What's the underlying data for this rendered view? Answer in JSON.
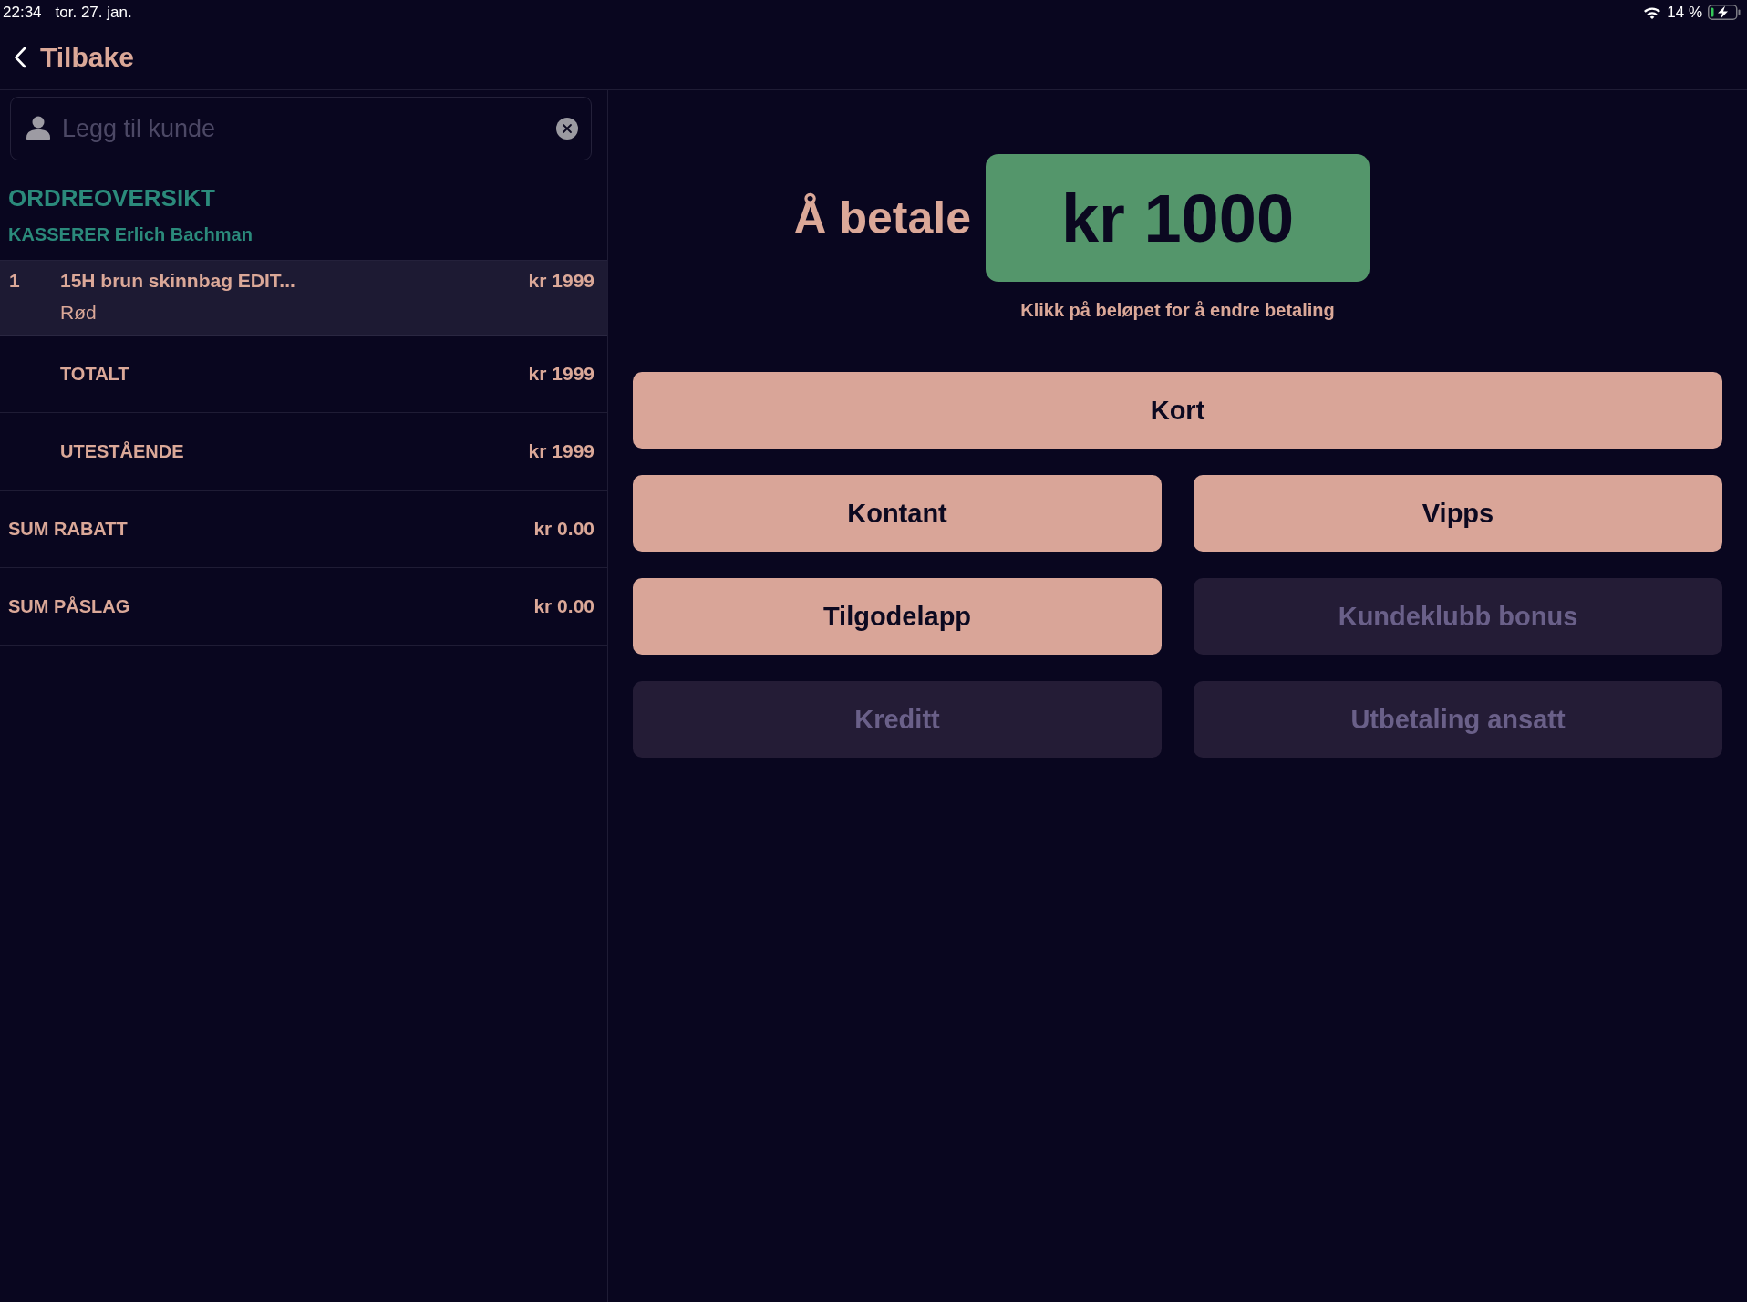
{
  "status_bar": {
    "time": "22:34",
    "date": "tor. 27. jan.",
    "battery": "14 %"
  },
  "nav": {
    "back": "Tilbake"
  },
  "customer_field": {
    "placeholder": "Legg til kunde"
  },
  "order": {
    "title": "ORDREOVERSIKT",
    "cashier": "KASSERER Erlich Bachman",
    "lines": [
      {
        "quantity": "1",
        "name": "15H brun skinnbag EDIT...",
        "variant": "Rød",
        "price": "kr 1999"
      }
    ],
    "summary": [
      {
        "kind": "total",
        "label": "TOTALT",
        "value": "kr 1999"
      },
      {
        "kind": "total",
        "label": "UTESTÅENDE",
        "value": "kr 1999"
      },
      {
        "kind": "sum",
        "label": "SUM RABATT",
        "value": "kr 0.00"
      },
      {
        "kind": "sum",
        "label": "SUM PÅSLAG",
        "value": "kr 0.00"
      }
    ]
  },
  "payment": {
    "label": "Å betale",
    "amount": "kr 1000",
    "hint": "Klikk på beløpet for å endre betaling",
    "method_rows": [
      [
        {
          "label": "Kort",
          "disabled": false
        }
      ],
      [
        {
          "label": "Kontant",
          "disabled": false
        },
        {
          "label": "Vipps",
          "disabled": false
        }
      ],
      [
        {
          "label": "Tilgodelapp",
          "disabled": false
        },
        {
          "label": "Kundeklubb bonus",
          "disabled": true
        }
      ],
      [
        {
          "label": "Kreditt",
          "disabled": true
        },
        {
          "label": "Utbetaling ansatt",
          "disabled": true
        }
      ]
    ]
  }
}
